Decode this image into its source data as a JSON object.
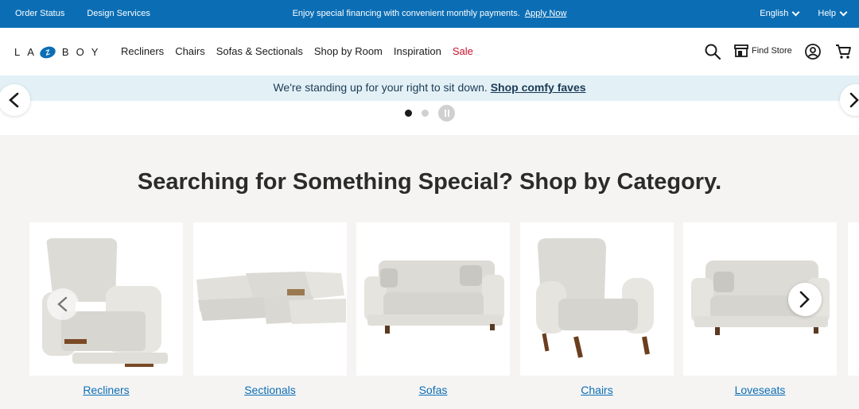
{
  "utility": {
    "order_status": "Order Status",
    "design_services": "Design Services",
    "promo_text": "Enjoy special financing with convenient monthly payments.",
    "apply_now": "Apply Now",
    "language": "English",
    "help": "Help"
  },
  "brand": {
    "logo_left": "LA",
    "logo_mark": "Z",
    "logo_right": "BOY"
  },
  "nav": {
    "items": [
      "Recliners",
      "Chairs",
      "Sofas & Sectionals",
      "Shop by Room",
      "Inspiration",
      "Sale"
    ],
    "find_store": "Find Store"
  },
  "icons": {
    "search": "search-icon",
    "store": "store-icon",
    "account": "account-icon",
    "cart": "cart-icon",
    "prev": "chevron-left-icon",
    "next": "chevron-right-icon",
    "pause": "pause-icon"
  },
  "promo": {
    "text": "We're standing up for your right to sit down.",
    "link": "Shop comfy faves"
  },
  "carousel": {
    "dots": 2,
    "active_dot": 1
  },
  "categories": {
    "title": "Searching for Something Special? Shop by Category.",
    "items": [
      {
        "label": "Recliners"
      },
      {
        "label": "Sectionals"
      },
      {
        "label": "Sofas"
      },
      {
        "label": "Chairs"
      },
      {
        "label": "Loveseats"
      }
    ]
  },
  "colors": {
    "utility_bar": "#0b6eb5",
    "promo_bg": "#e3f1f6",
    "sale": "#c8102e",
    "section_bg": "#f5f4f3"
  }
}
